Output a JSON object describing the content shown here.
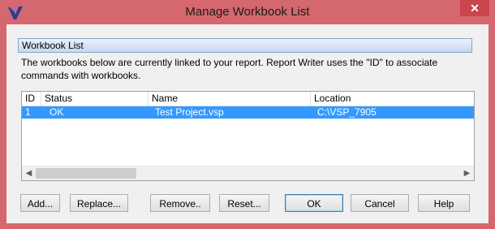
{
  "window": {
    "title": "Manage Workbook List",
    "close_glyph": "✕"
  },
  "section": {
    "header": "Workbook List",
    "description": "The workbooks below are currently linked to your report.  Report Writer uses the \"ID\" to associate commands with workbooks."
  },
  "table": {
    "columns": [
      "ID",
      "Status",
      "Name",
      "Location"
    ],
    "rows": [
      {
        "id": "1",
        "status": "OK",
        "name": "Test Project.vsp",
        "location": "C:\\VSP_7905"
      }
    ],
    "selected_row_color": "#3399ff"
  },
  "scrollbar": {
    "left_arrow": "◀",
    "right_arrow": "▶"
  },
  "buttons": {
    "add": "Add...",
    "replace": "Replace...",
    "remove": "Remove..",
    "reset": "Reset...",
    "ok": "OK",
    "cancel": "Cancel",
    "help": "Help"
  },
  "colors": {
    "frame": "#d5676e",
    "accent_v": "#2e3b8f"
  }
}
